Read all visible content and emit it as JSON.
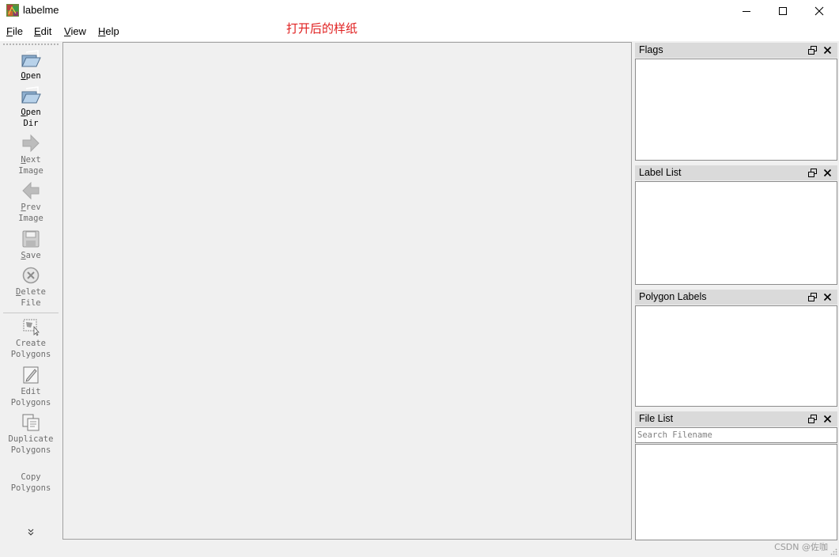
{
  "window": {
    "title": "labelme",
    "icon": "labelme-app-icon",
    "controls": [
      "minimize-icon",
      "maximize-icon",
      "close-icon"
    ]
  },
  "menu": {
    "items": [
      {
        "label": "File",
        "mnemonic": "F"
      },
      {
        "label": "Edit",
        "mnemonic": "E"
      },
      {
        "label": "View",
        "mnemonic": "V"
      },
      {
        "label": "Help",
        "mnemonic": "H"
      }
    ]
  },
  "annotation": {
    "text": "打开后的样纸",
    "color": "#e02020"
  },
  "toolbar": {
    "tools": [
      {
        "label": "Open",
        "icon": "open-folder-icon",
        "enabled": true
      },
      {
        "label": "Open\nDir",
        "icon": "open-dir-icon",
        "enabled": true
      },
      {
        "label": "Next\nImage",
        "icon": "next-arrow-icon",
        "enabled": false
      },
      {
        "label": "Prev\nImage",
        "icon": "prev-arrow-icon",
        "enabled": false
      },
      {
        "label": "Save",
        "icon": "save-icon",
        "enabled": false
      },
      {
        "label": "Delete\nFile",
        "icon": "delete-icon",
        "enabled": false
      },
      {
        "label": "Create\nPolygons",
        "icon": "create-polygon-icon",
        "enabled": false
      },
      {
        "label": "Edit\nPolygons",
        "icon": "edit-polygon-icon",
        "enabled": false
      },
      {
        "label": "Duplicate\nPolygons",
        "icon": "duplicate-icon",
        "enabled": false
      },
      {
        "label": "Copy\nPolygons",
        "icon": "",
        "enabled": false
      }
    ],
    "extension_icon": "chevron-double-down-icon"
  },
  "docks": {
    "flags": {
      "title": "Flags"
    },
    "label_list": {
      "title": "Label List"
    },
    "polygon_labels": {
      "title": "Polygon Labels"
    },
    "file_list": {
      "title": "File List",
      "search_placeholder": "Search Filename"
    },
    "float_icon": "dock-float-icon",
    "close_icon": "dock-close-icon"
  },
  "statusbar": {
    "watermark": "CSDN @佐咖"
  }
}
